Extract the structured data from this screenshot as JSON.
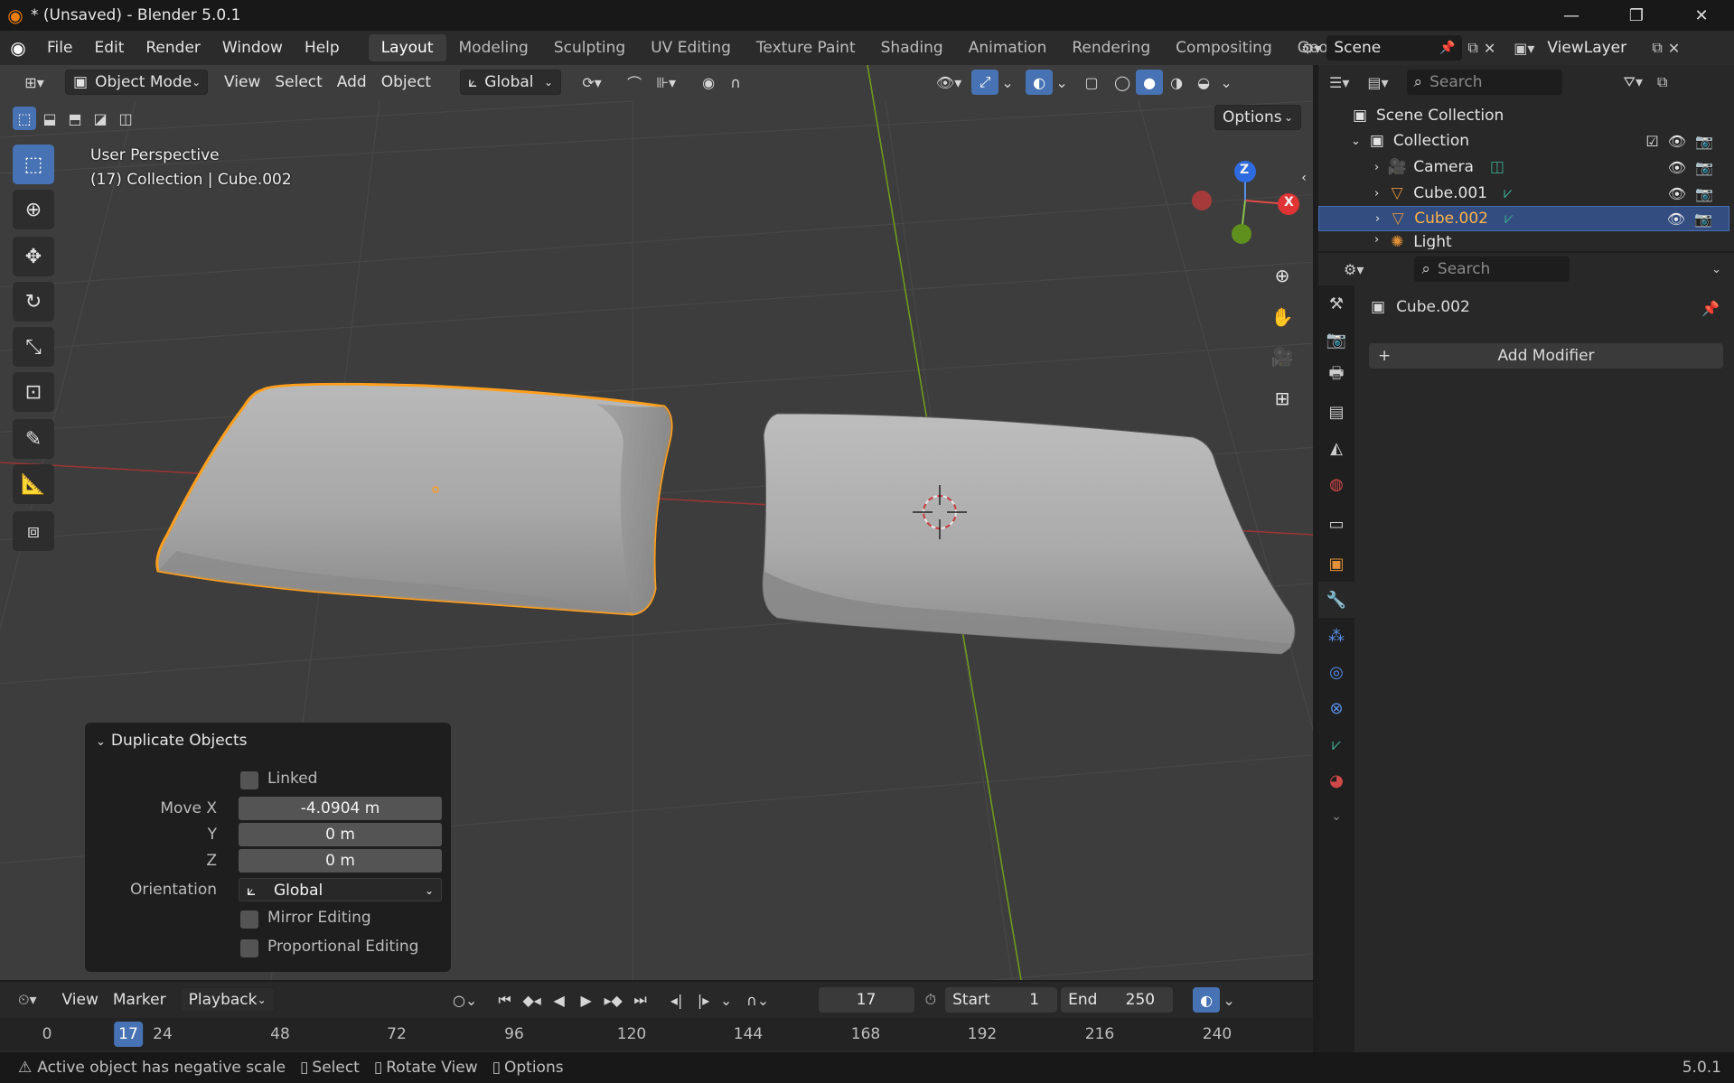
{
  "window": {
    "title": "* (Unsaved) - Blender 5.0.1",
    "min": "—",
    "max": "❐",
    "close": "✕"
  },
  "menu": [
    "File",
    "Edit",
    "Render",
    "Window",
    "Help"
  ],
  "workspaces": [
    "Layout",
    "Modeling",
    "Sculpting",
    "UV Editing",
    "Texture Paint",
    "Shading",
    "Animation",
    "Rendering",
    "Compositing",
    "Geometr"
  ],
  "scene": {
    "name": "Scene",
    "view_layer": "ViewLayer"
  },
  "viewport": {
    "mode": "Object Mode",
    "menus": [
      "View",
      "Select",
      "Add",
      "Object"
    ],
    "orientation": "Global",
    "options_label": "Options",
    "info_line1": "User Perspective",
    "info_line2": "(17) Collection | Cube.002",
    "gizmo": {
      "z": "Z",
      "x": "X"
    }
  },
  "redo_panel": {
    "title": "Duplicate Objects",
    "linked_label": "Linked",
    "move_x_label": "Move X",
    "move_x": "-4.0904 m",
    "y_label": "Y",
    "move_y": "0 m",
    "z_label": "Z",
    "move_z": "0 m",
    "orientation_label": "Orientation",
    "orientation": "Global",
    "mirror_label": "Mirror Editing",
    "proportional_label": "Proportional Editing"
  },
  "outliner": {
    "search_placeholder": "Search",
    "scene_collection": "Scene Collection",
    "collection": "Collection",
    "items": [
      "Camera",
      "Cube.001",
      "Cube.002",
      "Light"
    ]
  },
  "properties": {
    "search_placeholder": "Search",
    "object_name": "Cube.002",
    "add_modifier": "Add Modifier"
  },
  "timeline": {
    "menus": [
      "View",
      "Marker"
    ],
    "playback": "Playback",
    "current_frame": "17",
    "start_label": "Start",
    "start": "1",
    "end_label": "End",
    "end": "250",
    "ticks": [
      "0",
      "17",
      "24",
      "48",
      "72",
      "96",
      "120",
      "144",
      "168",
      "192",
      "216",
      "240"
    ]
  },
  "status": {
    "warning": "Active object has negative scale",
    "select": "Select",
    "rotate": "Rotate View",
    "options": "Options",
    "version": "5.0.1"
  },
  "colors": {
    "accent": "#4772b3",
    "selection": "#ff9f1c",
    "axis_x": "#c83c3c",
    "axis_y": "#6e9a1e"
  }
}
